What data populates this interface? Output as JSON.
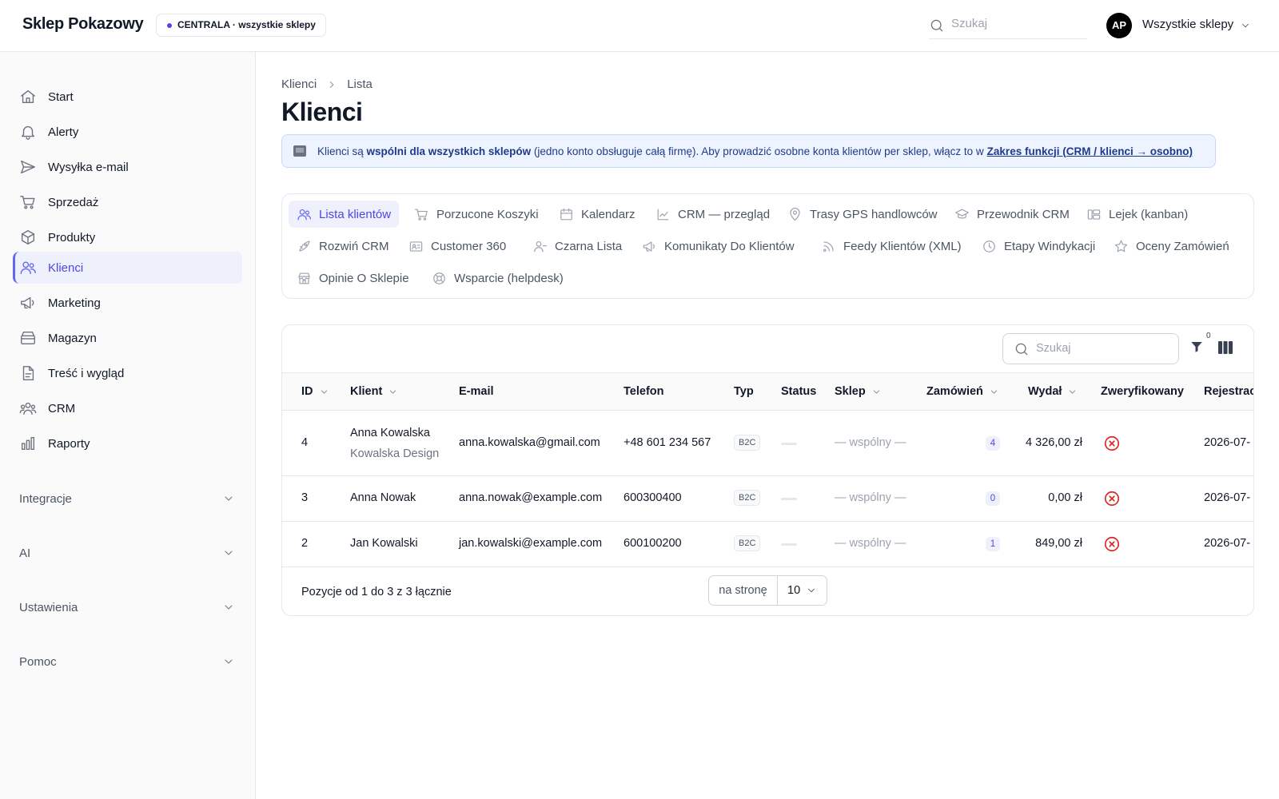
{
  "app": {
    "brand": "Sklep Pokazowy",
    "scope_badge": "CENTRALA · wszystkie sklepy",
    "search_placeholder": "Szukaj",
    "avatar_initials": "AP",
    "store_select": "Wszystkie sklepy"
  },
  "sidebar": {
    "items": [
      {
        "label": "Start",
        "icon": "home-icon"
      },
      {
        "label": "Alerty",
        "icon": "bell-icon"
      },
      {
        "label": "Wysyłka e-mail",
        "icon": "send-icon"
      },
      {
        "label": "Sprzedaż",
        "icon": "cart-icon"
      },
      {
        "label": "Produkty",
        "icon": "box-icon"
      },
      {
        "label": "Klienci",
        "icon": "users-icon",
        "active": true
      },
      {
        "label": "Marketing",
        "icon": "megaphone-icon"
      },
      {
        "label": "Magazyn",
        "icon": "archive-icon"
      },
      {
        "label": "Treść i wygląd",
        "icon": "document-icon"
      },
      {
        "label": "CRM",
        "icon": "group-icon"
      },
      {
        "label": "Raporty",
        "icon": "bar-chart-icon"
      }
    ],
    "groups": [
      "Integracje",
      "AI",
      "Ustawienia",
      "Pomoc"
    ]
  },
  "breadcrumb": {
    "root": "Klienci",
    "current": "Lista"
  },
  "page_title": "Klienci",
  "banner": {
    "text_start": "Klienci są",
    "text_bold": "wspólni dla wszystkich sklepów",
    "text_middle": "(jedno konto obsługuje całą firmę). Aby prowadzić osobne konta klientów per sklep, włącz to w",
    "link": "Zakres funkcji (CRM / klienci → osobno)"
  },
  "tabs": [
    {
      "label": "Lista klientów",
      "icon": "users-icon",
      "active": true
    },
    {
      "label": "Porzucone Koszyki",
      "icon": "cart-icon"
    },
    {
      "label": "Kalendarz",
      "icon": "calendar-icon"
    },
    {
      "label": "CRM — przegląd",
      "icon": "chart-line-icon"
    },
    {
      "label": "Trasy GPS handlowców",
      "icon": "map-pin-icon"
    },
    {
      "label": "Przewodnik CRM",
      "icon": "graduation-icon"
    },
    {
      "label": "Lejek (kanban)",
      "icon": "kanban-icon"
    },
    {
      "label": "Rozwiń CRM",
      "icon": "rocket-icon"
    },
    {
      "label": "Customer 360",
      "icon": "id-card-icon"
    },
    {
      "label": "Czarna Lista",
      "icon": "user-minus-icon"
    },
    {
      "label": "Komunikaty Do Klientów",
      "icon": "megaphone-icon"
    },
    {
      "label": "Feedy Klientów (XML)",
      "icon": "rss-icon"
    },
    {
      "label": "Etapy Windykacji",
      "icon": "clock-icon"
    },
    {
      "label": "Oceny Zamówień",
      "icon": "star-icon"
    },
    {
      "label": "Opinie O Sklepie",
      "icon": "store-icon"
    },
    {
      "label": "Wsparcie (helpdesk)",
      "icon": "lifebuoy-icon"
    }
  ],
  "table": {
    "search_placeholder": "Szukaj",
    "filter_count": "0",
    "columns": [
      "ID",
      "Klient",
      "E-mail",
      "Telefon",
      "Typ",
      "Status",
      "Sklep",
      "Zamówień",
      "Wydał",
      "Zweryfikowany",
      "Rejestrac"
    ],
    "rows": [
      {
        "id": "4",
        "name": "Anna Kowalska",
        "company": "Kowalska Design",
        "email": "anna.kowalska@gmail.com",
        "phone": "+48 601 234 567",
        "type": "B2C",
        "store": "— wspólny —",
        "orders": "4",
        "spent": "4 326,00 zł",
        "verified": false,
        "registered": "2026-07-"
      },
      {
        "id": "3",
        "name": "Anna Nowak",
        "company": "",
        "email": "anna.nowak@example.com",
        "phone": "600300400",
        "type": "B2C",
        "store": "— wspólny —",
        "orders": "0",
        "spent": "0,00 zł",
        "verified": false,
        "registered": "2026-07-"
      },
      {
        "id": "2",
        "name": "Jan Kowalski",
        "company": "",
        "email": "jan.kowalski@example.com",
        "phone": "600100200",
        "type": "B2C",
        "store": "— wspólny —",
        "orders": "1",
        "spent": "849,00 zł",
        "verified": false,
        "registered": "2026-07-"
      }
    ],
    "footer_text": "Pozycje od 1 do 3 z 3 łącznie",
    "per_page_label": "na stronę",
    "per_page_value": "10"
  },
  "colors": {
    "accent": "#6366f1",
    "accent_text": "#4f46e5",
    "active_bg": "#eef0fb",
    "danger": "#dc2626",
    "banner_bg": "#eef4ff"
  }
}
